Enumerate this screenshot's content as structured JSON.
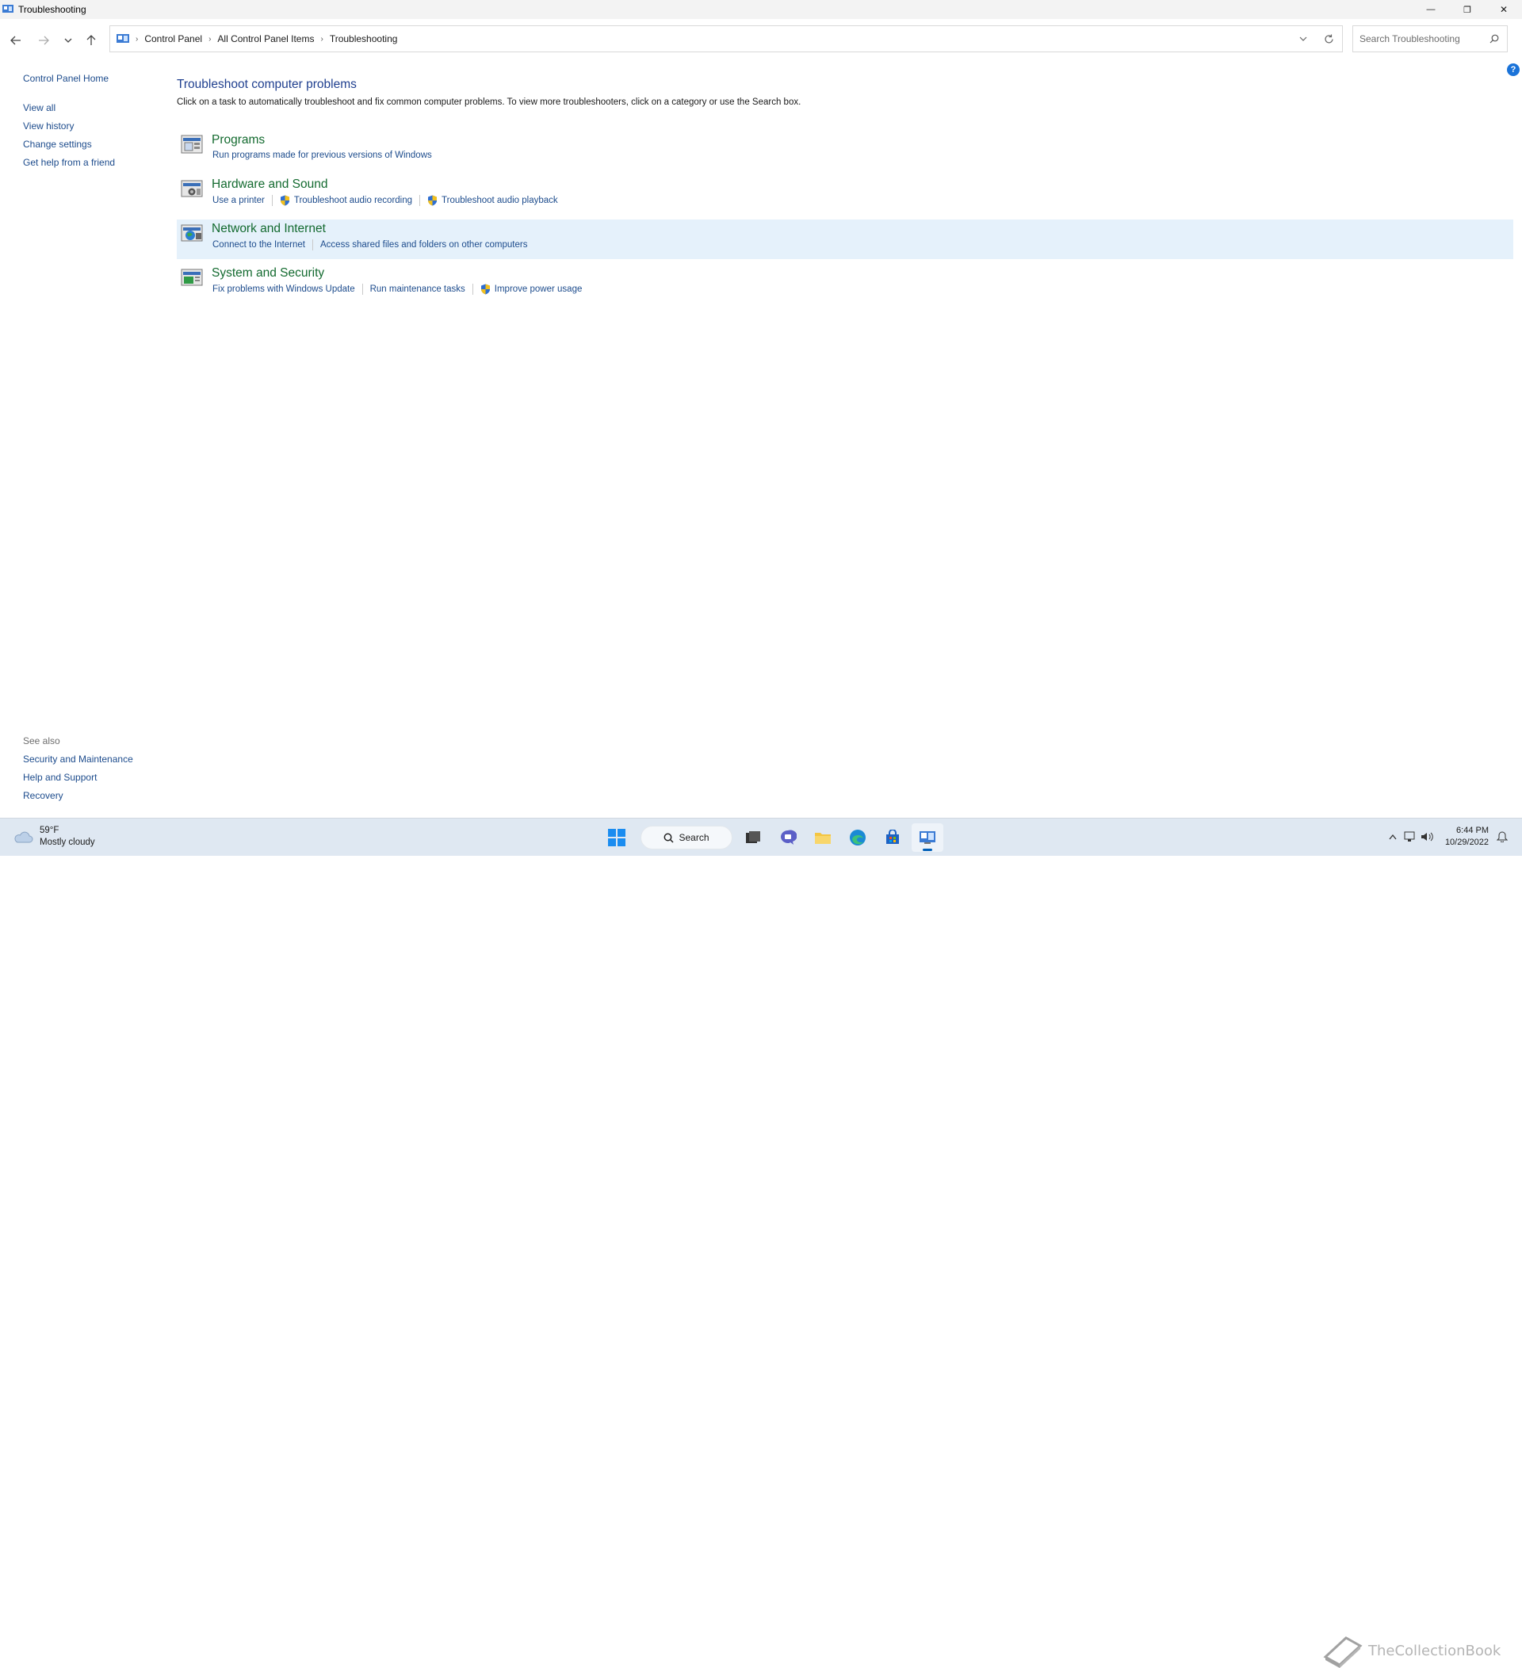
{
  "window": {
    "title": "Troubleshooting",
    "minimize_glyph": "—",
    "restore_glyph": "❐",
    "close_glyph": "✕"
  },
  "address": {
    "crumbs": [
      "Control Panel",
      "All Control Panel Items",
      "Troubleshooting"
    ],
    "search_placeholder": "Search Troubleshooting"
  },
  "sidebar": {
    "home": "Control Panel Home",
    "items": [
      "View all",
      "View history",
      "Change settings",
      "Get help from a friend"
    ]
  },
  "main": {
    "heading": "Troubleshoot computer problems",
    "intro": "Click on a task to automatically troubleshoot and fix common computer problems. To view more troubleshooters, click on a category or use the Search box.",
    "categories": [
      {
        "title": "Programs",
        "icon": "programs-icon",
        "links": [
          {
            "label": "Run programs made for previous versions of Windows",
            "shield": false
          }
        ]
      },
      {
        "title": "Hardware and Sound",
        "icon": "hardware-sound-icon",
        "links": [
          {
            "label": "Use a printer",
            "shield": false
          },
          {
            "label": "Troubleshoot audio recording",
            "shield": true
          },
          {
            "label": "Troubleshoot audio playback",
            "shield": true
          }
        ]
      },
      {
        "title": "Network and Internet",
        "icon": "network-icon",
        "highlighted": true,
        "links": [
          {
            "label": "Connect to the Internet",
            "shield": false
          },
          {
            "label": "Access shared files and folders on other computers",
            "shield": false
          }
        ]
      },
      {
        "title": "System and Security",
        "icon": "system-security-icon",
        "links": [
          {
            "label": "Fix problems with Windows Update",
            "shield": false
          },
          {
            "label": "Run maintenance tasks",
            "shield": false
          },
          {
            "label": "Improve power usage",
            "shield": true
          }
        ]
      }
    ]
  },
  "see_also": {
    "heading": "See also",
    "items": [
      "Security and Maintenance",
      "Help and Support",
      "Recovery"
    ]
  },
  "taskbar": {
    "weather_temp": "59°F",
    "weather_desc": "Mostly cloudy",
    "search_label": "Search",
    "time": "6:44 PM",
    "date": "10/29/2022",
    "watermark": "TheCollectionBook"
  },
  "colors": {
    "link": "#1c4b8c",
    "category_title": "#136a2f",
    "highlight": "#e5f1fb",
    "taskbar": "#dfe8f2"
  }
}
